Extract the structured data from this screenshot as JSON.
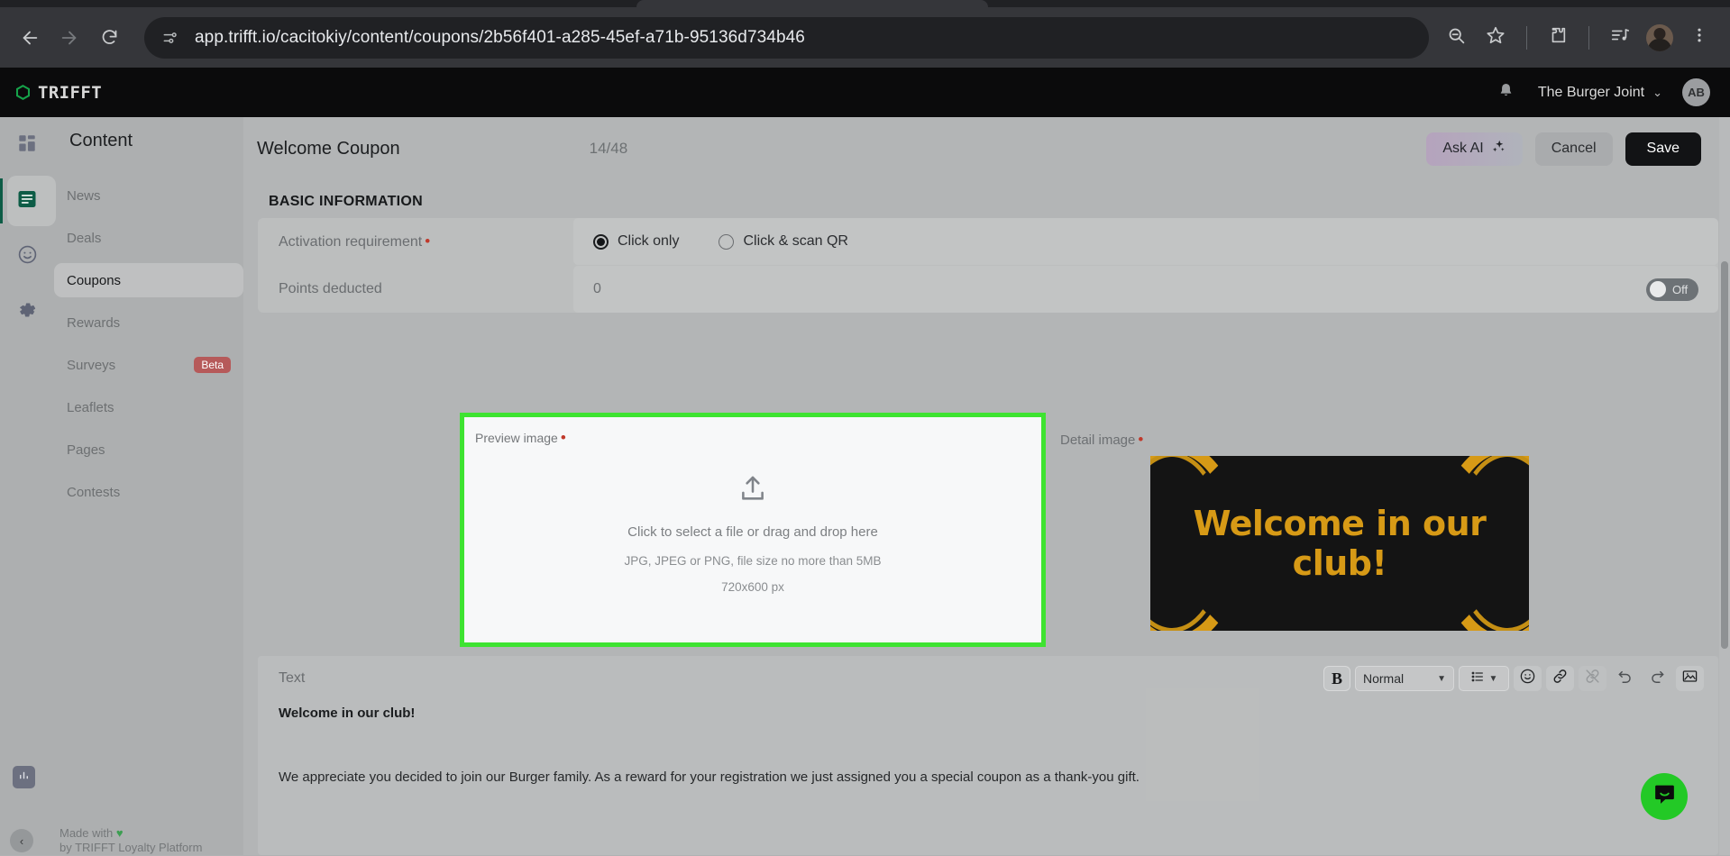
{
  "browser": {
    "url": "app.trifft.io/cacitokiy/content/coupons/2b56f401-a285-45ef-a71b-95136d734b46",
    "back_icon": "back-arrow-icon",
    "forward_icon": "forward-arrow-icon",
    "reload_icon": "reload-icon",
    "site_info_icon": "site-settings-icon",
    "zoom_icon": "zoom-out-icon",
    "bookmark_icon": "star-icon",
    "extensions_icon": "extensions-puzzle-icon",
    "media_icon": "media-playlist-icon",
    "profile_icon": "profile-avatar-icon",
    "menu_icon": "three-dot-menu-icon"
  },
  "app_header": {
    "brand": "TRIFFT",
    "notifications_icon": "bell-icon",
    "tenant": "The Burger Joint",
    "tenant_chevron": "⌄",
    "user_initials": "AB"
  },
  "sidebar": {
    "title": "Content",
    "rail": [
      {
        "name": "dashboard-icon",
        "active": false
      },
      {
        "name": "content-icon",
        "active": true
      },
      {
        "name": "engagement-smiley-icon",
        "active": false
      },
      {
        "name": "settings-gear-icon",
        "active": false
      }
    ],
    "items": [
      {
        "label": "News",
        "selected": false,
        "badge": ""
      },
      {
        "label": "Deals",
        "selected": false,
        "badge": ""
      },
      {
        "label": "Coupons",
        "selected": true,
        "badge": ""
      },
      {
        "label": "Rewards",
        "selected": false,
        "badge": ""
      },
      {
        "label": "Surveys",
        "selected": false,
        "badge": "Beta"
      },
      {
        "label": "Leaflets",
        "selected": false,
        "badge": ""
      },
      {
        "label": "Pages",
        "selected": false,
        "badge": ""
      },
      {
        "label": "Contests",
        "selected": false,
        "badge": ""
      }
    ],
    "stats_icon": "bar-chart-icon",
    "collapse_icon": "‹",
    "footer_line1": "Made with",
    "footer_heart": "♥",
    "footer_line2": "by TRIFFT Loyalty Platform"
  },
  "page": {
    "title": "Welcome Coupon",
    "counter": "14/48",
    "ask_ai_label": "Ask AI",
    "ask_ai_icon": "sparkles-icon",
    "cancel_label": "Cancel",
    "save_label": "Save",
    "section_label": "BASIC INFORMATION"
  },
  "form": {
    "activation": {
      "label": "Activation requirement",
      "required_marker": "•",
      "options": [
        {
          "label": "Click only",
          "checked": true
        },
        {
          "label": "Click & scan QR",
          "checked": false
        }
      ]
    },
    "points": {
      "label": "Points deducted",
      "value": "0",
      "toggle_state": "Off"
    }
  },
  "preview_image": {
    "label": "Preview image",
    "required_marker": "•",
    "upload_icon": "upload-arrow-icon",
    "primary_text": "Click to select a file or drag and drop here",
    "secondary_text": "JPG, JPEG or PNG, file size no more than 5MB",
    "dimensions_text": "720x600 px",
    "highlight_color": "#3ee331"
  },
  "detail_image": {
    "label": "Detail image",
    "required_marker": "•",
    "image_caption": "Welcome in our club!",
    "image_bg": "#141414",
    "image_accent": "#d79a16"
  },
  "editor": {
    "label": "Text",
    "toolbar": {
      "bold_label": "B",
      "format_value": "Normal",
      "format_caret": "▼",
      "list_icon": "bullet-list-icon",
      "list_caret": "▼",
      "emoji_icon": "emoji-smiley-icon",
      "link_icon": "link-icon",
      "unlink_icon": "unlink-icon",
      "undo_icon": "undo-icon",
      "redo_icon": "redo-icon",
      "image_icon": "insert-image-icon"
    },
    "heading": "Welcome in our club!",
    "paragraph": "We appreciate you decided to join our Burger family. As a reward for your registration we just assigned you a special coupon as a thank-you gift."
  },
  "chat": {
    "icon": "chat-bubble-icon",
    "color": "#23c926"
  }
}
